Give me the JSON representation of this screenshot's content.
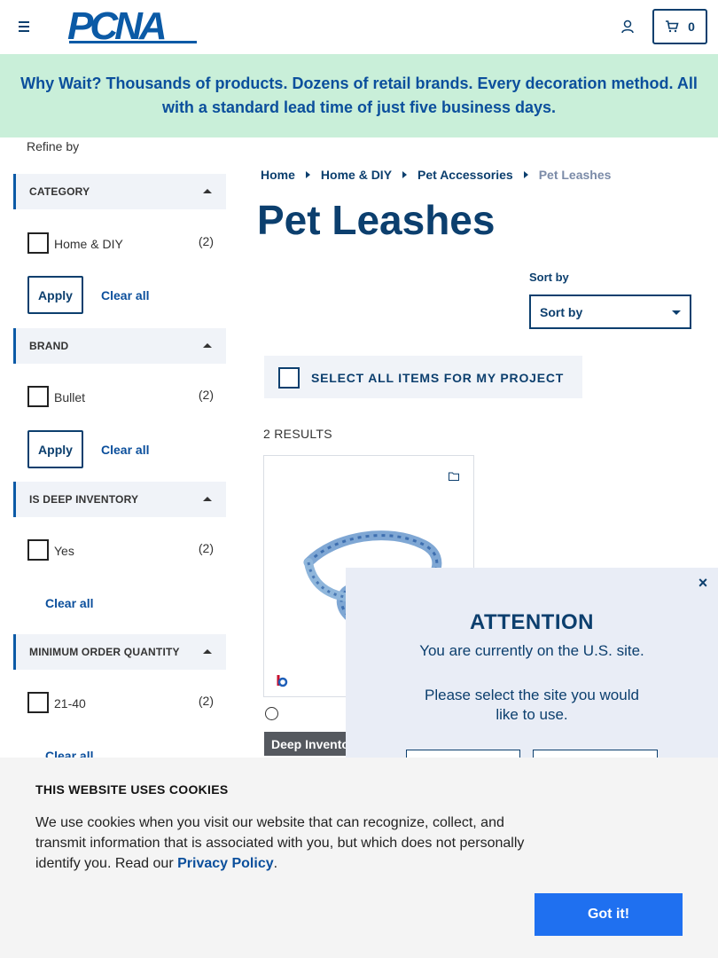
{
  "header": {
    "logo_text": "PCNA",
    "cart_count": "0"
  },
  "banner": {
    "text": "Why Wait? Thousands of products. Dozens of retail brands. Every decoration method. All with a standard lead time of just five business days."
  },
  "sidebar": {
    "refine_label": "Refine by",
    "apply_label": "Apply",
    "clear_label": "Clear all",
    "facets": [
      {
        "title": "CATEGORY",
        "option": "Home & DIY",
        "count": "(2)"
      },
      {
        "title": "BRAND",
        "option": "Bullet",
        "count": "(2)"
      },
      {
        "title": "IS DEEP INVENTORY",
        "option": "Yes",
        "count": "(2)"
      },
      {
        "title": "MINIMUM ORDER QUANTITY",
        "option": "21-40",
        "count": "(2)"
      }
    ]
  },
  "breadcrumb": {
    "items": [
      "Home",
      "Home & DIY",
      "Pet Accessories"
    ],
    "current": "Pet Leashes"
  },
  "main": {
    "title": "Pet Leashes",
    "sort_label": "Sort by",
    "sort_value": "Sort by",
    "select_all_label": "SELECT ALL ITEMS FOR MY PROJECT",
    "results": "2 RESULTS",
    "product": {
      "tag": "Deep Inventory"
    }
  },
  "modal": {
    "title": "ATTENTION",
    "line1": "You are currently on the U.S. site.",
    "line2": "Please select the site you would like to use.",
    "close": "×"
  },
  "cookie": {
    "title": "THIS WEBSITE USES COOKIES",
    "text": "We use cookies when you visit our website that can recognize, collect, and transmit information that is associated with you, but which does not personally identify you. Read our ",
    "link": "Privacy Policy",
    "period": ".",
    "button": "Got it!"
  }
}
